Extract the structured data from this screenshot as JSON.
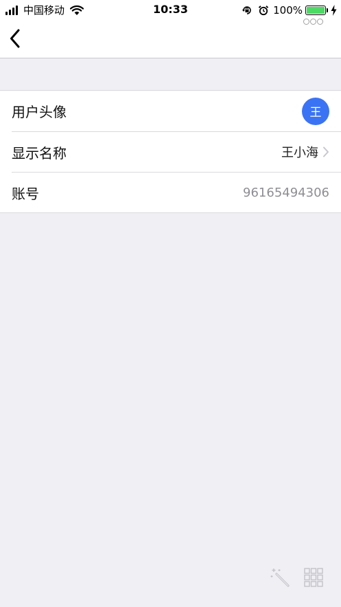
{
  "status_bar": {
    "carrier": "中国移动",
    "time": "10:33",
    "battery": "100%",
    "icons": [
      "signal-icon",
      "wifi-icon",
      "rotation-lock-icon",
      "alarm-icon",
      "battery-icon",
      "charging-bolt-icon"
    ]
  },
  "nav": {
    "back_icon": "chevron-left-icon",
    "more_icon": "more-dots-icon"
  },
  "profile": {
    "avatar_label": "用户头像",
    "avatar_text": "王",
    "avatar_color": "#3b73f5",
    "display_name_label": "显示名称",
    "display_name_value": "王小海",
    "account_label": "账号",
    "account_value": "96165494306"
  },
  "tools": {
    "icons": [
      "magic-wand-icon",
      "grid-icon"
    ]
  }
}
